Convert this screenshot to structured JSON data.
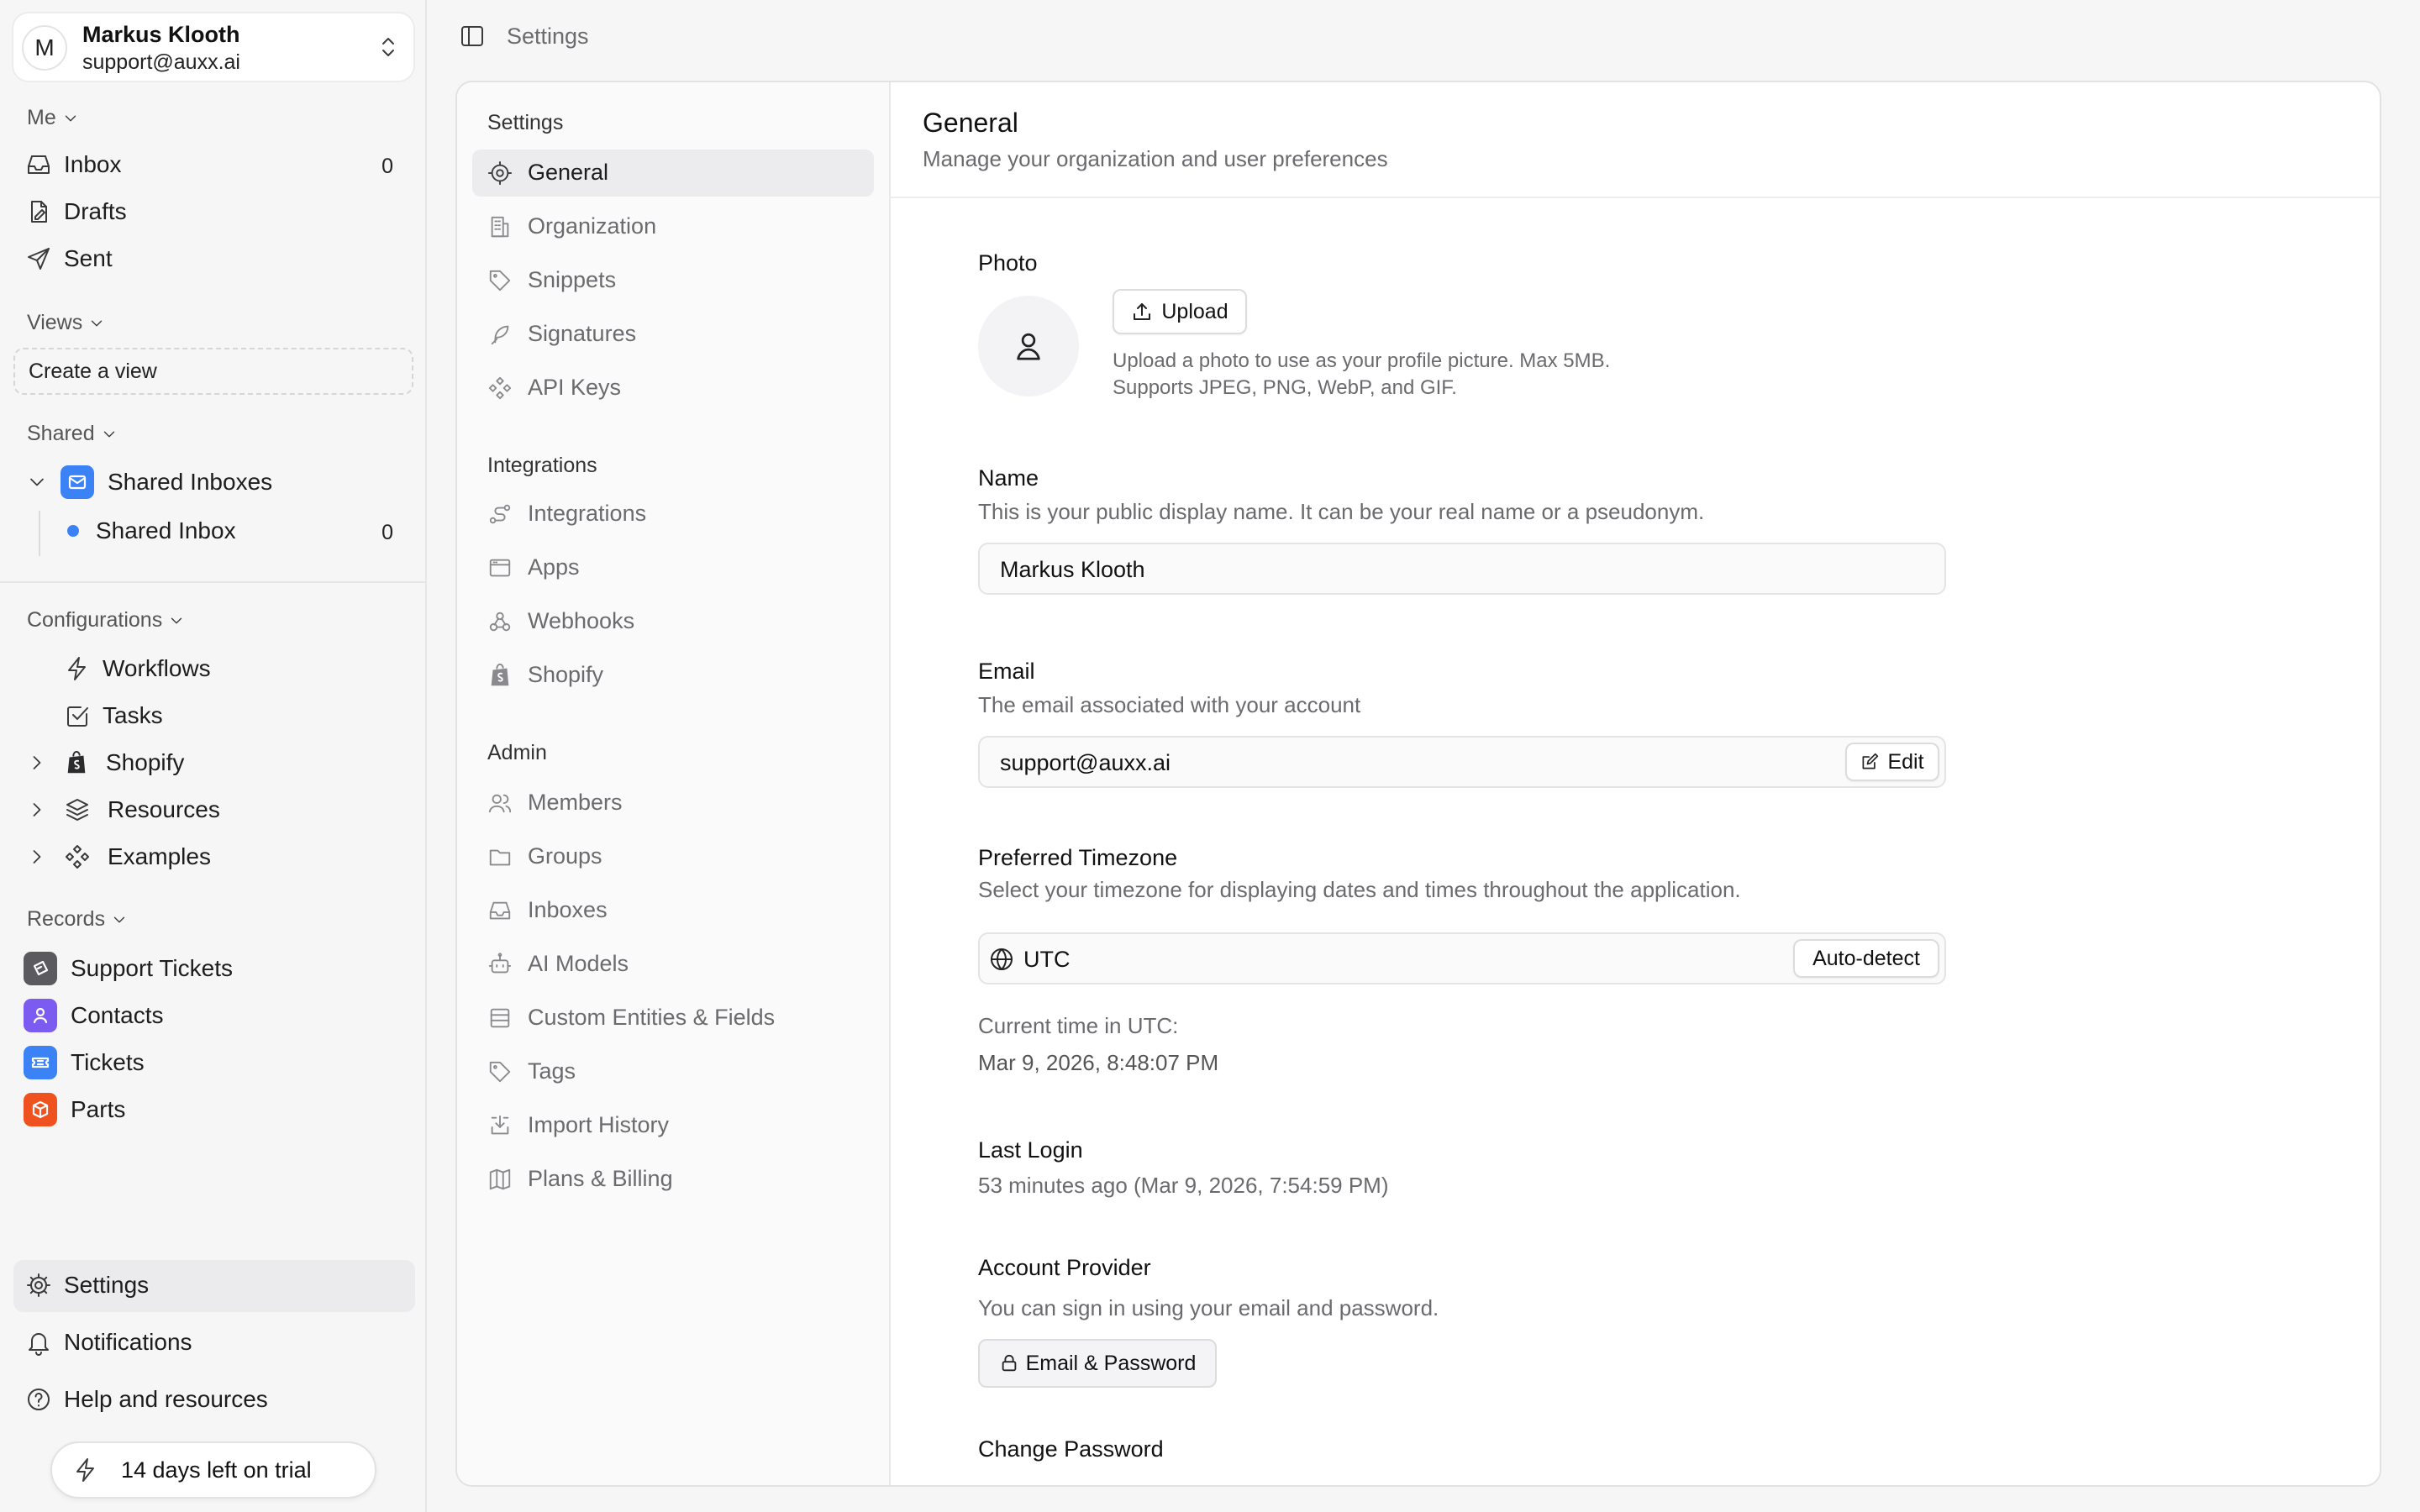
{
  "user": {
    "initial": "M",
    "name": "Markus Klooth",
    "email": "support@auxx.ai"
  },
  "sidebar": {
    "me_label": "Me",
    "me_items": [
      {
        "label": "Inbox",
        "count": "0"
      },
      {
        "label": "Drafts"
      },
      {
        "label": "Sent"
      }
    ],
    "views_label": "Views",
    "create_view": "Create a view",
    "shared_label": "Shared",
    "shared_inboxes": "Shared Inboxes",
    "shared_inbox": {
      "label": "Shared Inbox",
      "count": "0"
    },
    "config_label": "Configurations",
    "config_items": [
      "Workflows",
      "Tasks",
      "Shopify",
      "Resources",
      "Examples"
    ],
    "records_label": "Records",
    "records": [
      "Support Tickets",
      "Contacts",
      "Tickets",
      "Parts"
    ],
    "bottom": [
      "Settings",
      "Notifications",
      "Help and resources"
    ],
    "trial": "14 days left on trial"
  },
  "topbar": {
    "title": "Settings"
  },
  "subnav": {
    "settings_head": "Settings",
    "settings_items": [
      "General",
      "Organization",
      "Snippets",
      "Signatures",
      "API Keys"
    ],
    "integrations_head": "Integrations",
    "integrations_items": [
      "Integrations",
      "Apps",
      "Webhooks",
      "Shopify"
    ],
    "admin_head": "Admin",
    "admin_items": [
      "Members",
      "Groups",
      "Inboxes",
      "AI Models",
      "Custom Entities & Fields",
      "Tags",
      "Import History",
      "Plans & Billing"
    ]
  },
  "general": {
    "title": "General",
    "subtitle": "Manage your organization and user preferences",
    "photo_label": "Photo",
    "upload": "Upload",
    "upload_help_1": "Upload a photo to use as your profile picture. Max 5MB.",
    "upload_help_2": "Supports JPEG, PNG, WebP, and GIF.",
    "name_label": "Name",
    "name_help": "This is your public display name. It can be your real name or a pseudonym.",
    "name_value": "Markus Klooth",
    "email_label": "Email",
    "email_help": "The email associated with your account",
    "email_value": "support@auxx.ai",
    "edit": "Edit",
    "tz_label": "Preferred Timezone",
    "tz_help": "Select your timezone for displaying dates and times throughout the application.",
    "tz_value": "UTC",
    "auto_detect": "Auto-detect",
    "current_time_label": "Current time in UTC:",
    "current_time": "Mar 9, 2026, 8:48:07 PM",
    "last_login_label": "Last Login",
    "last_login": "53 minutes ago (Mar 9, 2026, 7:54:59 PM)",
    "provider_label": "Account Provider",
    "provider_help": "You can sign in using your email and password.",
    "provider_badge": "Email & Password",
    "change_password": "Change Password"
  },
  "colors": {
    "accent_blue": "#3b82f6",
    "support_tickets": "#5b5b5f",
    "contacts": "#7c5cf0",
    "tickets": "#3b82f6",
    "parts": "#f0521f"
  }
}
